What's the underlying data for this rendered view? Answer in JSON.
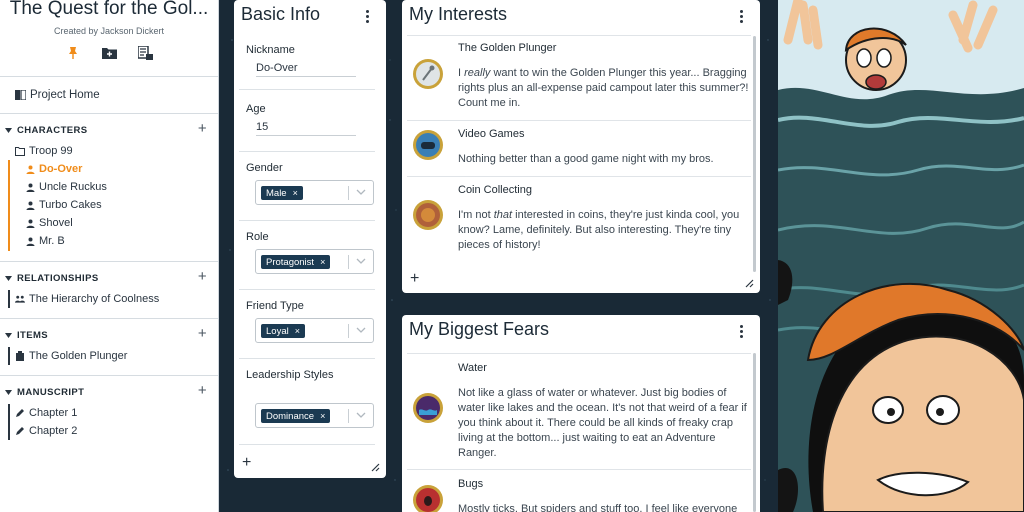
{
  "sidebar": {
    "title": "The Quest for the Gol...",
    "created_by": "Created by Jackson Dickert",
    "project_home": "Project Home",
    "sections": {
      "characters": {
        "label": "CHARACTERS",
        "folder": "Troop 99",
        "items": [
          "Do-Over",
          "Uncle Ruckus",
          "Turbo Cakes",
          "Shovel",
          "Mr. B"
        ]
      },
      "relationships": {
        "label": "RELATIONSHIPS",
        "items": [
          "The Hierarchy of Coolness"
        ]
      },
      "items": {
        "label": "ITEMS",
        "items": [
          "The Golden Plunger"
        ]
      },
      "manuscript": {
        "label": "MANUSCRIPT",
        "items": [
          "Chapter 1",
          "Chapter 2"
        ]
      }
    }
  },
  "basic_info": {
    "title": "Basic Info",
    "nickname": {
      "label": "Nickname",
      "value": "Do-Over"
    },
    "age": {
      "label": "Age",
      "value": "15"
    },
    "gender": {
      "label": "Gender",
      "value": "Male"
    },
    "role": {
      "label": "Role",
      "value": "Protagonist"
    },
    "friend_type": {
      "label": "Friend Type",
      "value": "Loyal"
    },
    "leadership": {
      "label": "Leadership Styles",
      "value": "Dominance"
    }
  },
  "interests": {
    "title": "My Interests",
    "entries": [
      {
        "title": "The Golden Plunger",
        "pre": "I ",
        "em": "really",
        "post": " want to win the Golden Plunger this year... Bragging rights plus an all-expense paid campout later this summer?! Count me in."
      },
      {
        "title": "Video Games",
        "text": "Nothing better than a good game night with my bros."
      },
      {
        "title": "Coin Collecting",
        "pre": "I'm not ",
        "em": "that",
        "post": " interested in coins, they're just kinda cool, you know? Lame, definitely. But also interesting. They're tiny pieces of history!"
      }
    ]
  },
  "fears": {
    "title": "My Biggest Fears",
    "entries": [
      {
        "title": "Water",
        "text": "Not like a glass of water or whatever. Just big bodies of water like lakes and the ocean. It's not that weird of a fear if you think about it. There could be all kinds of freaky crap living at the bottom... just waiting to eat an Adventure Ranger."
      },
      {
        "title": "Bugs",
        "text": "Mostly ticks. But spiders and stuff too. I feel like everyone"
      }
    ]
  },
  "colors": {
    "accent": "#f08c1a",
    "chip": "#1b3a52",
    "background": "#1b2b3a"
  }
}
